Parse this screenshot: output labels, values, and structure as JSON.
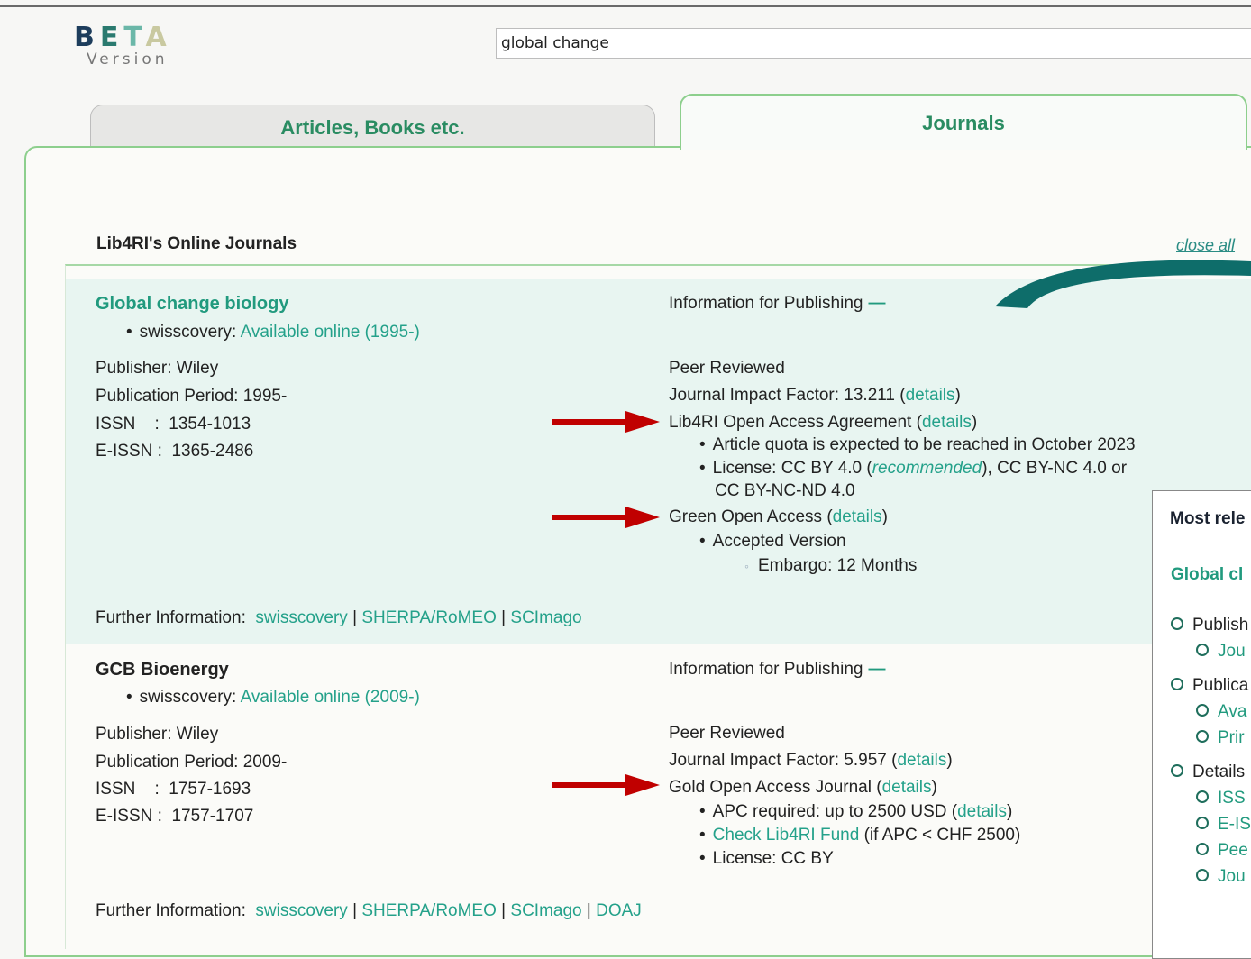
{
  "header": {
    "logo_letters": [
      "B",
      "E",
      "T",
      "A"
    ],
    "logo_sub": "Version",
    "search_value": "global change"
  },
  "tabs": [
    {
      "label": "Articles, Books etc.",
      "active": false
    },
    {
      "label": "Journals",
      "active": true
    }
  ],
  "list": {
    "title": "Lib4RI's Online Journals",
    "close_all": "close all"
  },
  "journals": [
    {
      "title": "Global change biology",
      "swisscovery_label": "swisscovery: ",
      "availability": "Available online (1995-)",
      "publisher": "Publisher: Wiley",
      "period": "Publication Period: 1995-",
      "issn": "ISSN    :  1354-1013",
      "eissn": "E-ISSN :  1365-2486",
      "info_heading": "Information for Publishing",
      "info_toggle": "—",
      "peer": "Peer Reviewed",
      "jif_prefix": "Journal Impact Factor: 13.211 (",
      "details": "details",
      "close_paren": ")",
      "oa_agreement_prefix": "Lib4RI Open Access Agreement (",
      "quota": "Article quota is expected to be reached in October 2023",
      "license_prefix": "License: CC BY 4.0 (",
      "recommended": "recommended",
      "license_suffix": "), CC BY-NC 4.0 or",
      "license_line2": "CC BY-NC-ND 4.0",
      "green_prefix": "Green Open Access (",
      "accepted": "Accepted Version",
      "embargo": "Embargo: 12 Months",
      "further_label": "Further Information:",
      "further_links": [
        "swisscovery",
        "SHERPA/RoMEO",
        "SCImago"
      ],
      "sep": " | "
    },
    {
      "title": "GCB Bioenergy",
      "swisscovery_label": "swisscovery: ",
      "availability": "Available online (2009-)",
      "publisher": "Publisher: Wiley",
      "period": "Publication Period: 2009-",
      "issn": "ISSN    :  1757-1693",
      "eissn": "E-ISSN :  1757-1707",
      "info_heading": "Information for Publishing",
      "info_toggle": "—",
      "peer": "Peer Reviewed",
      "jif_prefix": "Journal Impact Factor: 5.957 (",
      "details": "details",
      "close_paren": ")",
      "gold_prefix": "Gold Open Access Journal (",
      "apc_prefix": "APC required: up to 2500 USD (",
      "fund_link": "Check Lib4RI Fund",
      "fund_suffix": " (if APC < CHF 2500)",
      "license": "License: CC BY",
      "further_label": "Further Information:",
      "further_links": [
        "swisscovery",
        "SHERPA/RoMEO",
        "SCImago",
        "DOAJ"
      ],
      "sep": " | "
    }
  ],
  "popup": {
    "heading": "Most rele",
    "title": "Global cl",
    "items": [
      {
        "text": "Publish",
        "level": 0
      },
      {
        "text": "Jou",
        "level": 1
      },
      {
        "text": "Publica",
        "level": 0
      },
      {
        "text": "Ava",
        "level": 1
      },
      {
        "text": "Prir",
        "level": 1
      },
      {
        "text": "Details",
        "level": 0
      },
      {
        "text": "ISS",
        "level": 1
      },
      {
        "text": "E-IS",
        "level": 1
      },
      {
        "text": "Pee",
        "level": 1
      },
      {
        "text": "Jou",
        "level": 1
      }
    ]
  },
  "colors": {
    "accent": "#219a7e",
    "arrow": "#c00000",
    "tab_border": "#8dcf8d",
    "curve": "#0e6d6a"
  }
}
